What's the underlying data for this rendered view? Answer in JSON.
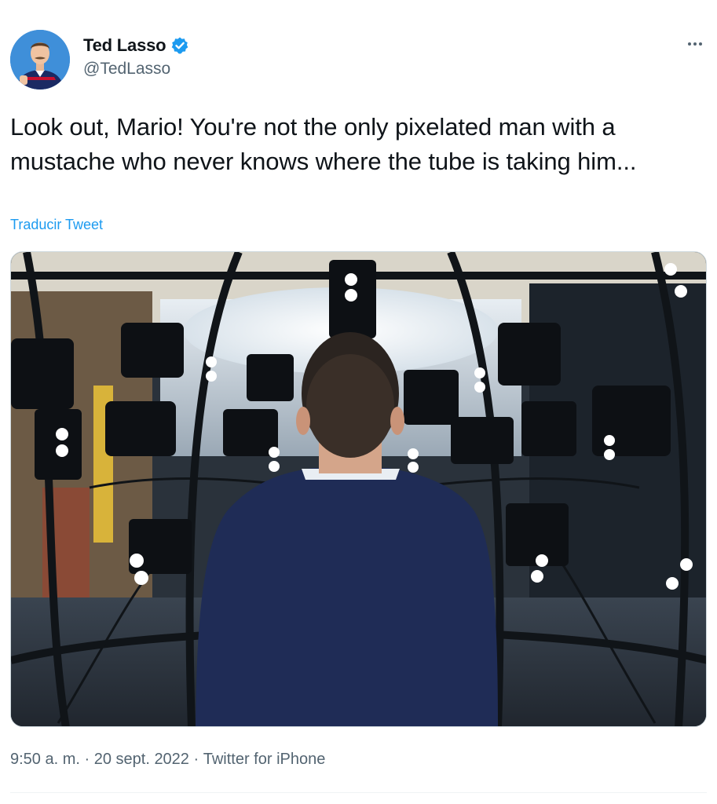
{
  "author": {
    "display_name": "Ted Lasso",
    "handle": "@TedLasso",
    "verified": true
  },
  "tweet": {
    "text": "Look out, Mario! You're not the only pixelated man with a mustache who never knows where the tube is taking him...",
    "translate_label": "Traducir Tweet"
  },
  "meta": {
    "time": "9:50 a. m.",
    "separator": " · ",
    "date": "20 sept. 2022",
    "source": "Twitter for iPhone"
  },
  "icons": {
    "verified": "verified-badge-icon",
    "more": "more-options-icon"
  },
  "colors": {
    "link": "#1d9bf0",
    "secondary_text": "#536471",
    "primary_text": "#0f1419"
  }
}
